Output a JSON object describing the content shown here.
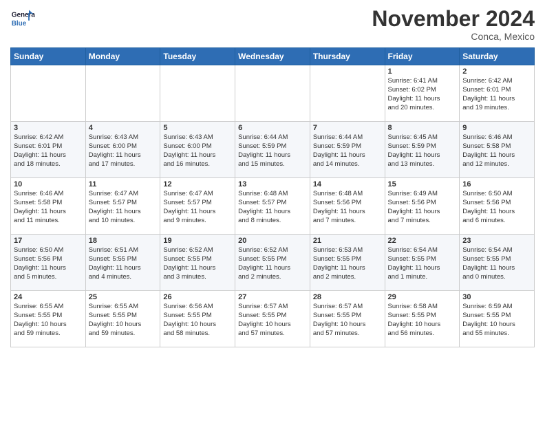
{
  "header": {
    "logo_line1": "General",
    "logo_line2": "Blue",
    "month": "November 2024",
    "location": "Conca, Mexico"
  },
  "days_of_week": [
    "Sunday",
    "Monday",
    "Tuesday",
    "Wednesday",
    "Thursday",
    "Friday",
    "Saturday"
  ],
  "weeks": [
    [
      {
        "day": "",
        "info": ""
      },
      {
        "day": "",
        "info": ""
      },
      {
        "day": "",
        "info": ""
      },
      {
        "day": "",
        "info": ""
      },
      {
        "day": "",
        "info": ""
      },
      {
        "day": "1",
        "info": "Sunrise: 6:41 AM\nSunset: 6:02 PM\nDaylight: 11 hours\nand 20 minutes."
      },
      {
        "day": "2",
        "info": "Sunrise: 6:42 AM\nSunset: 6:01 PM\nDaylight: 11 hours\nand 19 minutes."
      }
    ],
    [
      {
        "day": "3",
        "info": "Sunrise: 6:42 AM\nSunset: 6:01 PM\nDaylight: 11 hours\nand 18 minutes."
      },
      {
        "day": "4",
        "info": "Sunrise: 6:43 AM\nSunset: 6:00 PM\nDaylight: 11 hours\nand 17 minutes."
      },
      {
        "day": "5",
        "info": "Sunrise: 6:43 AM\nSunset: 6:00 PM\nDaylight: 11 hours\nand 16 minutes."
      },
      {
        "day": "6",
        "info": "Sunrise: 6:44 AM\nSunset: 5:59 PM\nDaylight: 11 hours\nand 15 minutes."
      },
      {
        "day": "7",
        "info": "Sunrise: 6:44 AM\nSunset: 5:59 PM\nDaylight: 11 hours\nand 14 minutes."
      },
      {
        "day": "8",
        "info": "Sunrise: 6:45 AM\nSunset: 5:59 PM\nDaylight: 11 hours\nand 13 minutes."
      },
      {
        "day": "9",
        "info": "Sunrise: 6:46 AM\nSunset: 5:58 PM\nDaylight: 11 hours\nand 12 minutes."
      }
    ],
    [
      {
        "day": "10",
        "info": "Sunrise: 6:46 AM\nSunset: 5:58 PM\nDaylight: 11 hours\nand 11 minutes."
      },
      {
        "day": "11",
        "info": "Sunrise: 6:47 AM\nSunset: 5:57 PM\nDaylight: 11 hours\nand 10 minutes."
      },
      {
        "day": "12",
        "info": "Sunrise: 6:47 AM\nSunset: 5:57 PM\nDaylight: 11 hours\nand 9 minutes."
      },
      {
        "day": "13",
        "info": "Sunrise: 6:48 AM\nSunset: 5:57 PM\nDaylight: 11 hours\nand 8 minutes."
      },
      {
        "day": "14",
        "info": "Sunrise: 6:48 AM\nSunset: 5:56 PM\nDaylight: 11 hours\nand 7 minutes."
      },
      {
        "day": "15",
        "info": "Sunrise: 6:49 AM\nSunset: 5:56 PM\nDaylight: 11 hours\nand 7 minutes."
      },
      {
        "day": "16",
        "info": "Sunrise: 6:50 AM\nSunset: 5:56 PM\nDaylight: 11 hours\nand 6 minutes."
      }
    ],
    [
      {
        "day": "17",
        "info": "Sunrise: 6:50 AM\nSunset: 5:56 PM\nDaylight: 11 hours\nand 5 minutes."
      },
      {
        "day": "18",
        "info": "Sunrise: 6:51 AM\nSunset: 5:55 PM\nDaylight: 11 hours\nand 4 minutes."
      },
      {
        "day": "19",
        "info": "Sunrise: 6:52 AM\nSunset: 5:55 PM\nDaylight: 11 hours\nand 3 minutes."
      },
      {
        "day": "20",
        "info": "Sunrise: 6:52 AM\nSunset: 5:55 PM\nDaylight: 11 hours\nand 2 minutes."
      },
      {
        "day": "21",
        "info": "Sunrise: 6:53 AM\nSunset: 5:55 PM\nDaylight: 11 hours\nand 2 minutes."
      },
      {
        "day": "22",
        "info": "Sunrise: 6:54 AM\nSunset: 5:55 PM\nDaylight: 11 hours\nand 1 minute."
      },
      {
        "day": "23",
        "info": "Sunrise: 6:54 AM\nSunset: 5:55 PM\nDaylight: 11 hours\nand 0 minutes."
      }
    ],
    [
      {
        "day": "24",
        "info": "Sunrise: 6:55 AM\nSunset: 5:55 PM\nDaylight: 10 hours\nand 59 minutes."
      },
      {
        "day": "25",
        "info": "Sunrise: 6:55 AM\nSunset: 5:55 PM\nDaylight: 10 hours\nand 59 minutes."
      },
      {
        "day": "26",
        "info": "Sunrise: 6:56 AM\nSunset: 5:55 PM\nDaylight: 10 hours\nand 58 minutes."
      },
      {
        "day": "27",
        "info": "Sunrise: 6:57 AM\nSunset: 5:55 PM\nDaylight: 10 hours\nand 57 minutes."
      },
      {
        "day": "28",
        "info": "Sunrise: 6:57 AM\nSunset: 5:55 PM\nDaylight: 10 hours\nand 57 minutes."
      },
      {
        "day": "29",
        "info": "Sunrise: 6:58 AM\nSunset: 5:55 PM\nDaylight: 10 hours\nand 56 minutes."
      },
      {
        "day": "30",
        "info": "Sunrise: 6:59 AM\nSunset: 5:55 PM\nDaylight: 10 hours\nand 55 minutes."
      }
    ]
  ]
}
